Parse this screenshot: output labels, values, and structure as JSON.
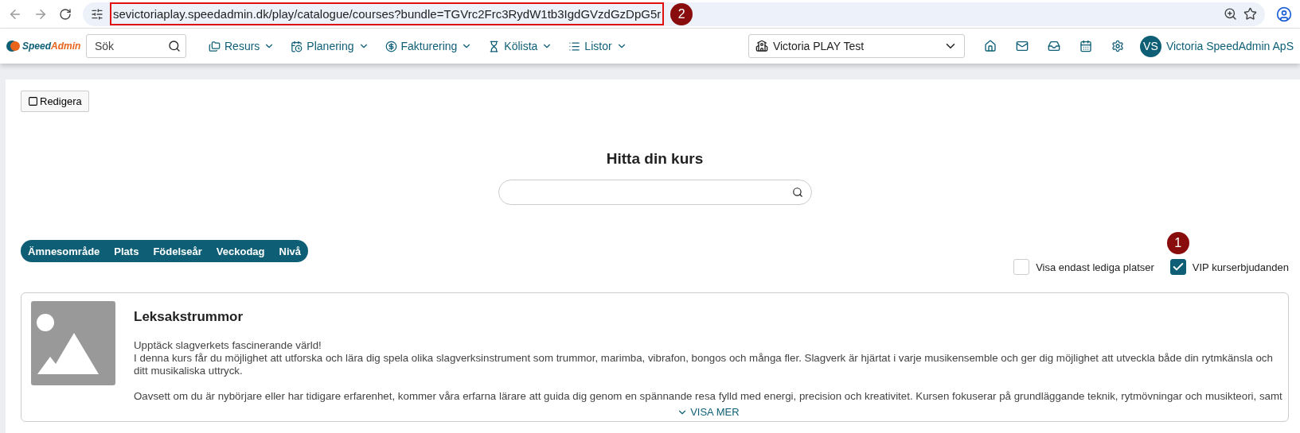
{
  "browser": {
    "url": "sevictoriaplay.speedadmin.dk/play/catalogue/courses?bundle=TGVrc2Frc3RydW1tb3IgdGVzdGzDpG5r"
  },
  "nav": {
    "logo": {
      "first": "Speed",
      "second": "Admin"
    },
    "search": {
      "placeholder": "Sök"
    },
    "menus": [
      {
        "kind": "folder",
        "label": "Resurs"
      },
      {
        "kind": "calendar",
        "label": "Planering"
      },
      {
        "kind": "dollar",
        "label": "Fakturering"
      },
      {
        "kind": "hourglass",
        "label": "Kölista"
      },
      {
        "kind": "list",
        "label": "Listor"
      }
    ],
    "school": {
      "value": "Victoria PLAY Test"
    },
    "actions": [
      {
        "kind": "home"
      },
      {
        "kind": "mail"
      },
      {
        "kind": "inbox"
      },
      {
        "kind": "calendar"
      },
      {
        "kind": "settings"
      }
    ],
    "user": {
      "initials": "VS",
      "name": "Victoria SpeedAdmin ApS"
    }
  },
  "edit_button": "Redigera",
  "heading": "Hitta din kurs",
  "filters": [
    {
      "label": "Ämnesområde"
    },
    {
      "label": "Plats"
    },
    {
      "label": "Födelseår"
    },
    {
      "label": "Veckodag"
    },
    {
      "label": "Nivå"
    }
  ],
  "checkboxes": [
    {
      "label": "Visa endast lediga platser",
      "checked": false
    },
    {
      "label": "VIP kurserbjudanden",
      "checked": true
    }
  ],
  "course": {
    "title": "Leksakstrummor",
    "paragraphs": [
      "Upptäck slagverkets fascinerande värld!\nI denna kurs får du möjlighet att utforska och lära dig spela olika slagverksinstrument som trummor, marimba, vibrafon, bongos och många fler. Slagverk är hjärtat i varje musikensemble och ger dig möjlighet att utveckla både din rytmkänsla och ditt musikaliska uttryck.",
      "Oavsett om du är nybörjare eller har tidigare erfarenhet, kommer våra erfarna lärare att guida dig genom en spännande resa fylld med energi, precision och kreativitet. Kursen fokuserar på grundläggande teknik, rytmövningar och musikteori, samt"
    ],
    "more": "VISA MER"
  },
  "annotations": [
    "1",
    "2"
  ]
}
